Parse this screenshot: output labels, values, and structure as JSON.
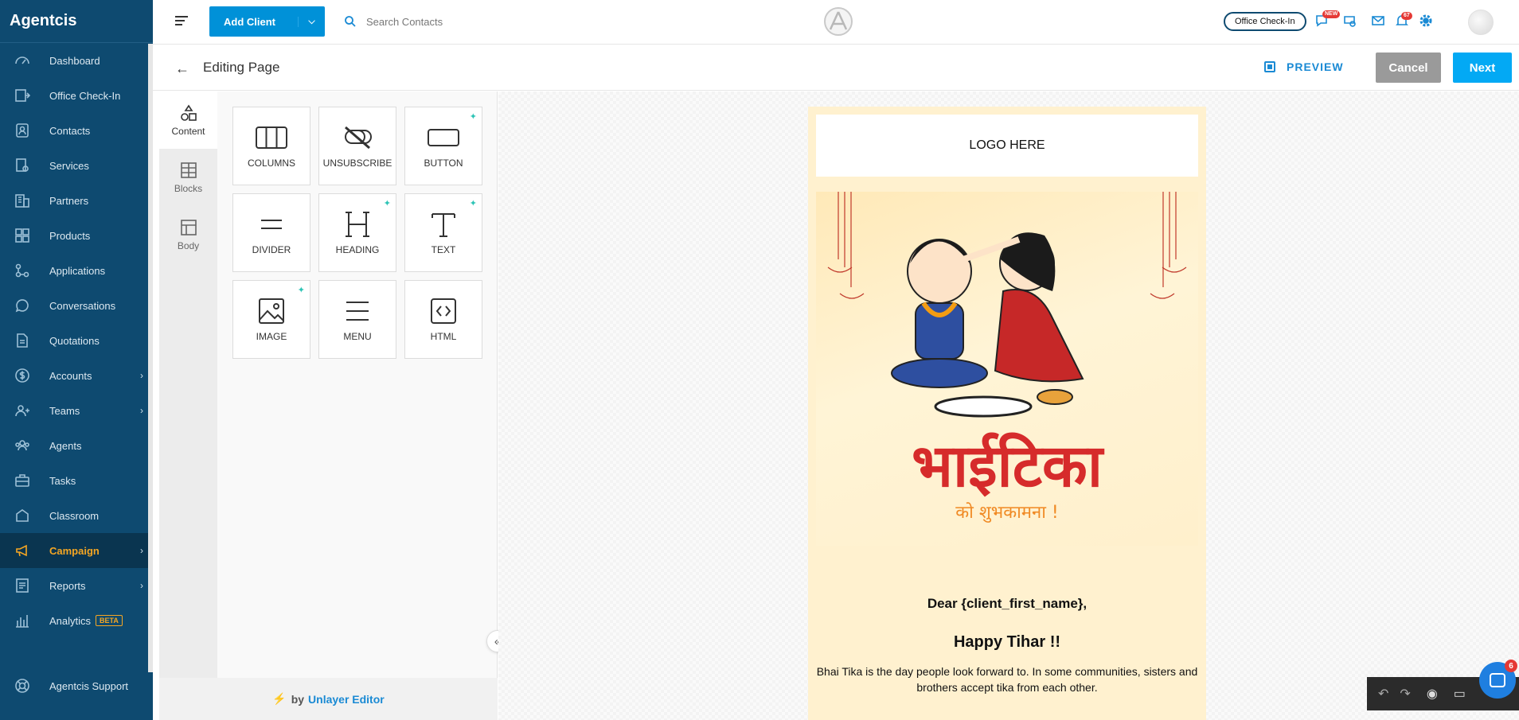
{
  "app": {
    "brand": "Agentcis"
  },
  "sidebar": {
    "items": [
      {
        "label": "Dashboard",
        "icon": "dashboard-icon"
      },
      {
        "label": "Office Check-In",
        "icon": "office-checkin-icon"
      },
      {
        "label": "Contacts",
        "icon": "contacts-icon"
      },
      {
        "label": "Services",
        "icon": "services-icon"
      },
      {
        "label": "Partners",
        "icon": "partners-icon"
      },
      {
        "label": "Products",
        "icon": "products-icon"
      },
      {
        "label": "Applications",
        "icon": "applications-icon"
      },
      {
        "label": "Conversations",
        "icon": "conversations-icon"
      },
      {
        "label": "Quotations",
        "icon": "quotations-icon"
      },
      {
        "label": "Accounts",
        "icon": "accounts-icon",
        "has_submenu": true
      },
      {
        "label": "Teams",
        "icon": "teams-icon",
        "has_submenu": true
      },
      {
        "label": "Agents",
        "icon": "agents-icon"
      },
      {
        "label": "Tasks",
        "icon": "tasks-icon"
      },
      {
        "label": "Classroom",
        "icon": "classroom-icon"
      },
      {
        "label": "Campaign",
        "icon": "campaign-icon",
        "has_submenu": true,
        "active": true
      },
      {
        "label": "Reports",
        "icon": "reports-icon",
        "has_submenu": true
      },
      {
        "label": "Analytics",
        "icon": "analytics-icon",
        "badge": "BETA"
      }
    ],
    "bottom": {
      "label": "Agentcis Support",
      "icon": "support-icon"
    }
  },
  "topbar": {
    "add_client_label": "Add Client",
    "search_placeholder": "Search Contacts",
    "office_checkin_label": "Office Check-In",
    "new_badge": "NEW",
    "notification_count": "67"
  },
  "editor": {
    "title": "Editing Page",
    "preview_label": "PREVIEW",
    "cancel_label": "Cancel",
    "next_label": "Next",
    "tabs": [
      {
        "label": "Content",
        "icon": "shapes-icon",
        "active": true
      },
      {
        "label": "Blocks",
        "icon": "blocks-icon"
      },
      {
        "label": "Body",
        "icon": "body-icon"
      }
    ],
    "tools": [
      {
        "label": "COLUMNS",
        "icon": "columns-icon",
        "sparkle": false
      },
      {
        "label": "UNSUBSCRIBE",
        "icon": "unlink-icon",
        "sparkle": false
      },
      {
        "label": "BUTTON",
        "icon": "button-icon",
        "sparkle": true
      },
      {
        "label": "DIVIDER",
        "icon": "divider-icon",
        "sparkle": false
      },
      {
        "label": "HEADING",
        "icon": "heading-icon",
        "sparkle": true
      },
      {
        "label": "TEXT",
        "icon": "text-icon",
        "sparkle": true
      },
      {
        "label": "IMAGE",
        "icon": "image-icon",
        "sparkle": true
      },
      {
        "label": "MENU",
        "icon": "menu-icon",
        "sparkle": false
      },
      {
        "label": "HTML",
        "icon": "code-icon",
        "sparkle": false
      }
    ],
    "powered_by": {
      "prefix": "by",
      "name": "Unlayer Editor"
    }
  },
  "email": {
    "logo_placeholder": "LOGO HERE",
    "hero_title": "भाईटिका",
    "hero_subtitle": "को शुभकामना !",
    "greeting": "Dear {client_first_name},",
    "headline": "Happy Tihar !!",
    "body": "Bhai Tika is the day people look forward to. In some communities, sisters and brothers accept tika from each other."
  },
  "chat": {
    "unread": "6"
  },
  "colors": {
    "sidebar_bg": "#0e4a70",
    "accent_blue": "#0091d8",
    "active_orange": "#f5a623",
    "email_bg": "#fff1cf",
    "hero_red": "#d62b2b",
    "hero_orange": "#f08a24"
  }
}
